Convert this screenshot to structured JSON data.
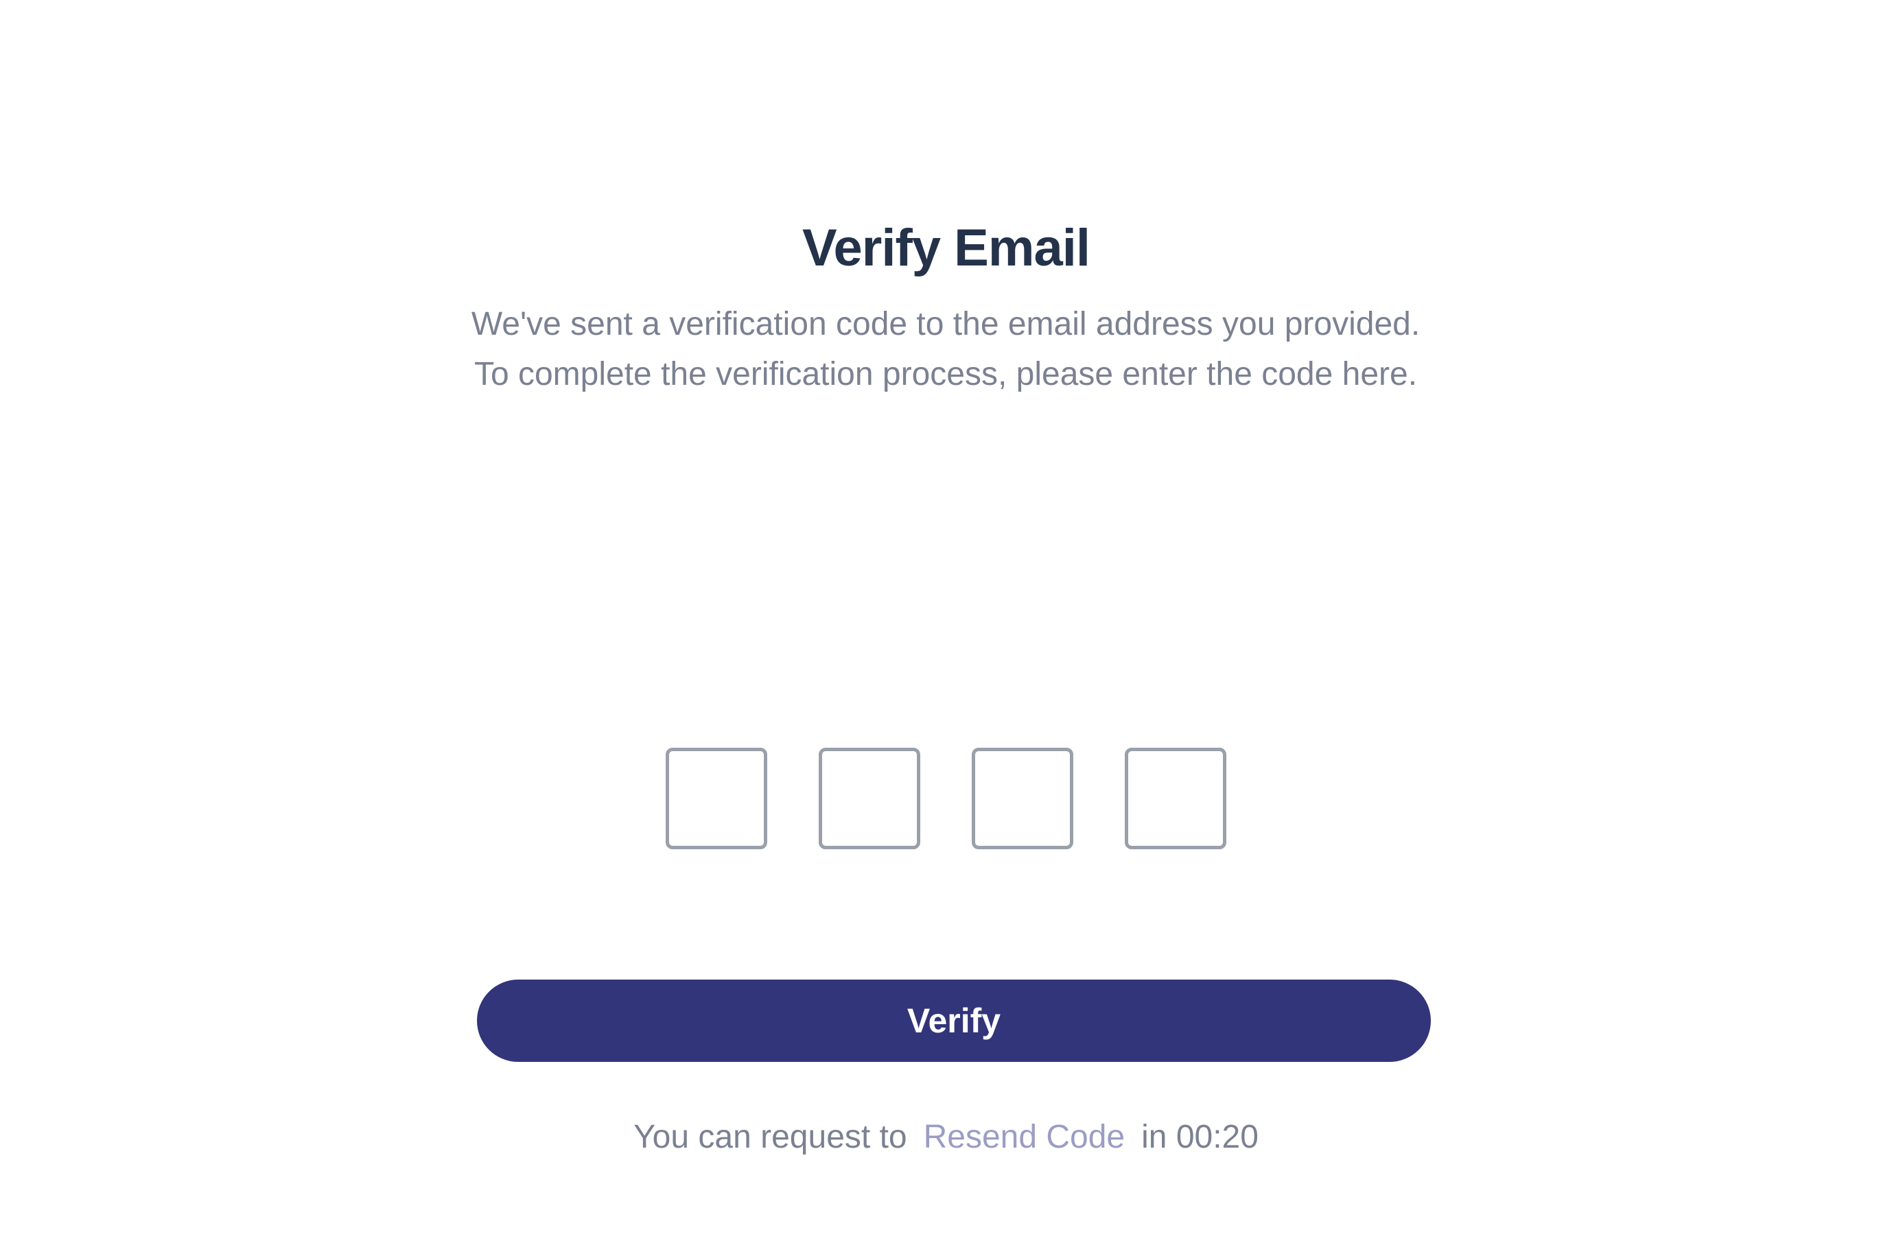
{
  "header": {
    "title": "Verify Email",
    "subtitle": "We've sent a verification code to the email address you provided. To complete the verification process, please enter the code here."
  },
  "otp": {
    "digits": [
      "",
      "",
      "",
      ""
    ]
  },
  "actions": {
    "verify_label": "Verify"
  },
  "resend": {
    "prefix": "You can request to",
    "link_label": "Resend Code",
    "suffix": "in 00:20"
  },
  "colors": {
    "title": "#24324a",
    "body_text": "#7b8191",
    "button_bg": "#32357a",
    "link": "#9c9dc4",
    "box_border": "#9aa0aa"
  }
}
